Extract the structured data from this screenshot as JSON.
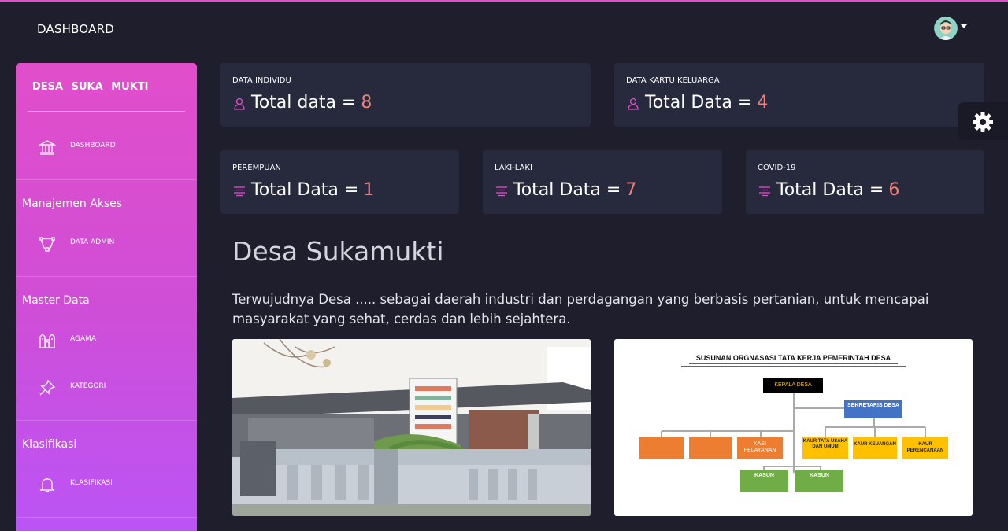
{
  "navbar": {
    "brand": "DASHBOARD",
    "avatar_icon": "avatar-icon"
  },
  "sidebar": {
    "title": "DESA SUKA MUKTI",
    "items": [
      {
        "label": "DASHBOARD",
        "icon": "bank-icon"
      },
      {
        "label": "DATA ADMIN",
        "icon": "vector-path-icon"
      },
      {
        "label": "AGAMA",
        "icon": "building-icon"
      },
      {
        "label": "KATEGORI",
        "icon": "pin-icon"
      },
      {
        "label": "KLASIFIKASI",
        "icon": "bell-icon"
      }
    ],
    "sections": [
      "Manajemen Akses",
      "Master Data",
      "Klasifikasi"
    ]
  },
  "cards": [
    {
      "category": "DATA INDIVIDU",
      "title": "Total data =",
      "value": "8",
      "icon": "user-icon"
    },
    {
      "category": "DATA KARTU KELUARGA",
      "title": "Total Data =",
      "value": "4",
      "icon": "user-icon"
    },
    {
      "category": "PEREMPUAN",
      "title": "Total Data =",
      "value": "1",
      "icon": "align-center-icon"
    },
    {
      "category": "LAKI-LAKI",
      "title": "Total Data =",
      "value": "7",
      "icon": "align-center-icon"
    },
    {
      "category": "COVID-19",
      "title": "Total Data =",
      "value": "6",
      "icon": "align-center-icon"
    }
  ],
  "main": {
    "heading": "Desa Sukamukti",
    "description": "Terwujudnya Desa ..... sebagai daerah industri dan perdagangan yang berbasis pertanian, untuk mencapai masyarakat yang sehat, cerdas dan lebih sejahtera."
  },
  "orgchart": {
    "title": "SUSUNAN ORGNASASI TATA KERJA PEMERINTAH DESA",
    "boxes": {
      "kepala": "KEPALA DESA",
      "sekretaris": "SEKRETARIS DESA",
      "kasi_pelayanan": "KASI PELAYANAN",
      "kaur_tu": "KAUR TATA USAHA DAN UMUM",
      "kaur_keuangan": "KAUR KEUANGAN",
      "kaur_perencanaan": "KAUR PERENCANAAN",
      "kasun": "KASUN"
    }
  },
  "colors": {
    "accent": "#e14eca",
    "sidebar_end": "#ba54f5",
    "card_bg": "#27293d",
    "value": "#f0807a",
    "page_bg": "#1e1e2d"
  },
  "settings_icon": "gear-icon"
}
